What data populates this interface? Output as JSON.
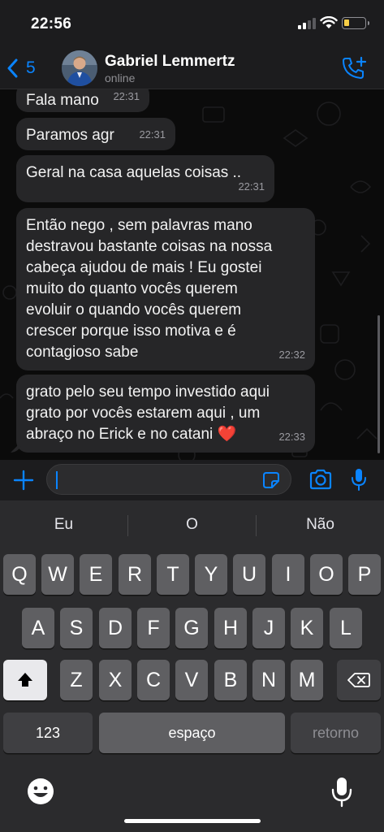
{
  "status_bar": {
    "time": "22:56"
  },
  "header": {
    "back_count": "5",
    "contact_name": "Gabriel Lemmertz",
    "contact_status": "online"
  },
  "messages": [
    {
      "text": "Fala mano",
      "time": "22:31"
    },
    {
      "text": "Paramos agr",
      "time": "22:31"
    },
    {
      "text": "Geral na casa aquelas coisas ..",
      "time": "22:31"
    },
    {
      "lines": [
        "Então nego , sem palavras mano",
        "destravou bastante coisas na nossa",
        "cabeça ajudou de mais ! Eu gostei",
        "muito do quanto vocês querem",
        "evoluir o quando vocês querem",
        "crescer porque isso motiva e é",
        "contagioso sabe"
      ],
      "time": "22:32"
    },
    {
      "lines": [
        "grato pelo seu tempo investido aqui",
        "grato por vocês estarem aqui , um",
        "abraço no Erick e no catani ❤️"
      ],
      "time": "22:33"
    }
  ],
  "input": {
    "value": ""
  },
  "keyboard": {
    "suggestions": [
      "Eu",
      "O",
      "Não"
    ],
    "row1": [
      "Q",
      "W",
      "E",
      "R",
      "T",
      "Y",
      "U",
      "I",
      "O",
      "P"
    ],
    "row2": [
      "A",
      "S",
      "D",
      "F",
      "G",
      "H",
      "J",
      "K",
      "L"
    ],
    "row3": [
      "Z",
      "X",
      "C",
      "V",
      "B",
      "N",
      "M"
    ],
    "numbers_label": "123",
    "space_label": "espaço",
    "return_label": "retorno"
  },
  "colors": {
    "accent": "#0a84ff",
    "bubble": "#262628",
    "heart": "#e0245e"
  },
  "icons": [
    "back-chevron-icon",
    "avatar-photo",
    "add-call-icon",
    "plus-icon",
    "sticker-icon",
    "camera-icon",
    "microphone-icon",
    "shift-icon",
    "delete-icon",
    "emoji-icon",
    "dictation-icon"
  ]
}
